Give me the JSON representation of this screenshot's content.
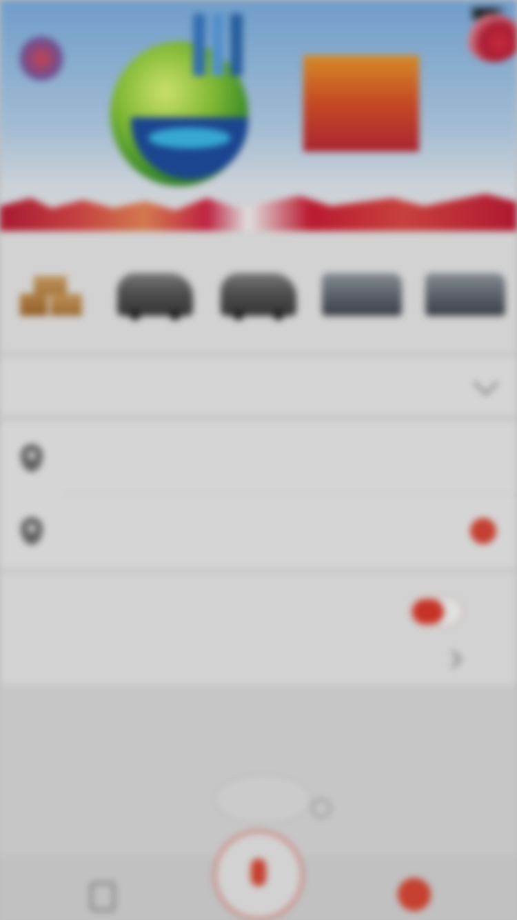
{
  "status_bar": {
    "carrier": "",
    "network": "",
    "time": "",
    "battery": ""
  },
  "banner": {
    "promo_headline": "",
    "promo_sub": ""
  },
  "vehicle_types": [
    {
      "label": "",
      "icon": "boxes-icon",
      "active": false
    },
    {
      "label": "",
      "icon": "van-icon",
      "active": true
    },
    {
      "label": "",
      "icon": "van-icon",
      "active": false
    },
    {
      "label": "",
      "icon": "truck-icon",
      "active": false
    },
    {
      "label": "",
      "icon": "truck-icon",
      "active": false
    }
  ],
  "service": {
    "label": ""
  },
  "address": {
    "start_placeholder": "",
    "end_placeholder": ""
  },
  "follow": {
    "title": "",
    "hint": "",
    "enabled": true
  },
  "passenger": {
    "label": "",
    "value": ""
  },
  "fee": {
    "prefix": "",
    "amount": "",
    "detail_link": "",
    "note": "",
    "note2": "",
    "coupon": ""
  },
  "tabbar": {
    "orders_label": "",
    "voice_label": "",
    "mine_label": ""
  },
  "colors": {
    "accent": "#e24a36",
    "background": "#e6e6e6"
  }
}
